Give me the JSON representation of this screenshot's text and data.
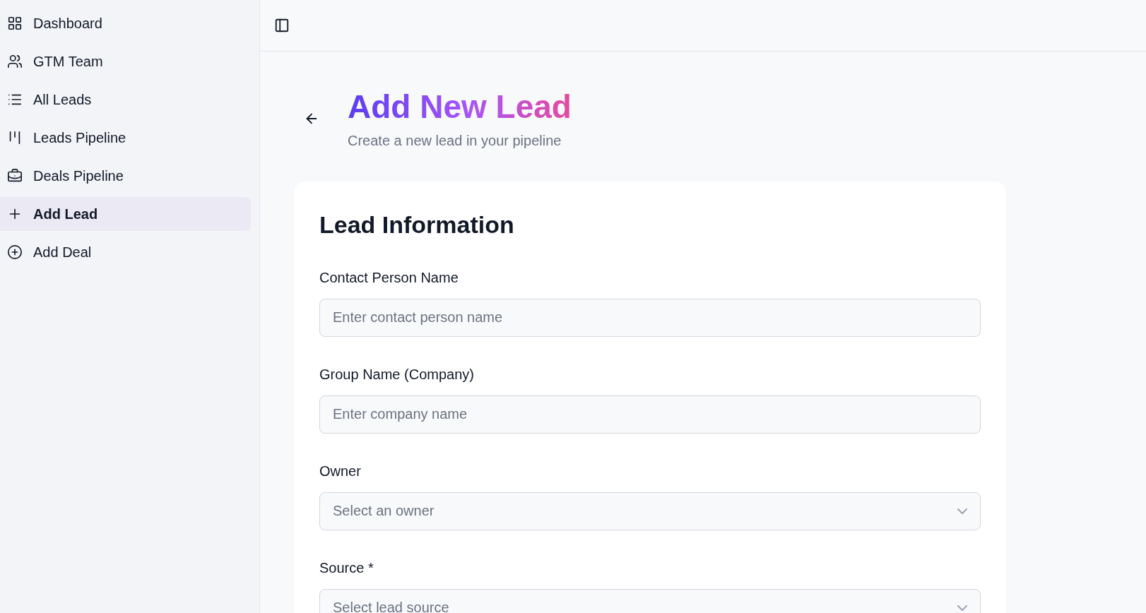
{
  "sidebar": {
    "items": [
      {
        "label": "Dashboard",
        "selected": false
      },
      {
        "label": "GTM Team",
        "selected": false
      },
      {
        "label": "All Leads",
        "selected": false
      },
      {
        "label": "Leads Pipeline",
        "selected": false
      },
      {
        "label": "Deals Pipeline",
        "selected": false
      },
      {
        "label": "Add Lead",
        "selected": true
      },
      {
        "label": "Add Deal",
        "selected": false
      }
    ]
  },
  "page": {
    "title": "Add New Lead",
    "subtitle": "Create a new lead in your pipeline"
  },
  "card": {
    "title": "Lead Information",
    "fields": [
      {
        "kind": "text",
        "label": "Contact Person Name",
        "placeholder": "Enter contact person name"
      },
      {
        "kind": "text",
        "label": "Group Name (Company)",
        "placeholder": "Enter company name"
      },
      {
        "kind": "select",
        "label": "Owner",
        "placeholder": "Select an owner"
      },
      {
        "kind": "select",
        "label": "Source *",
        "placeholder": "Select lead source"
      }
    ]
  }
}
